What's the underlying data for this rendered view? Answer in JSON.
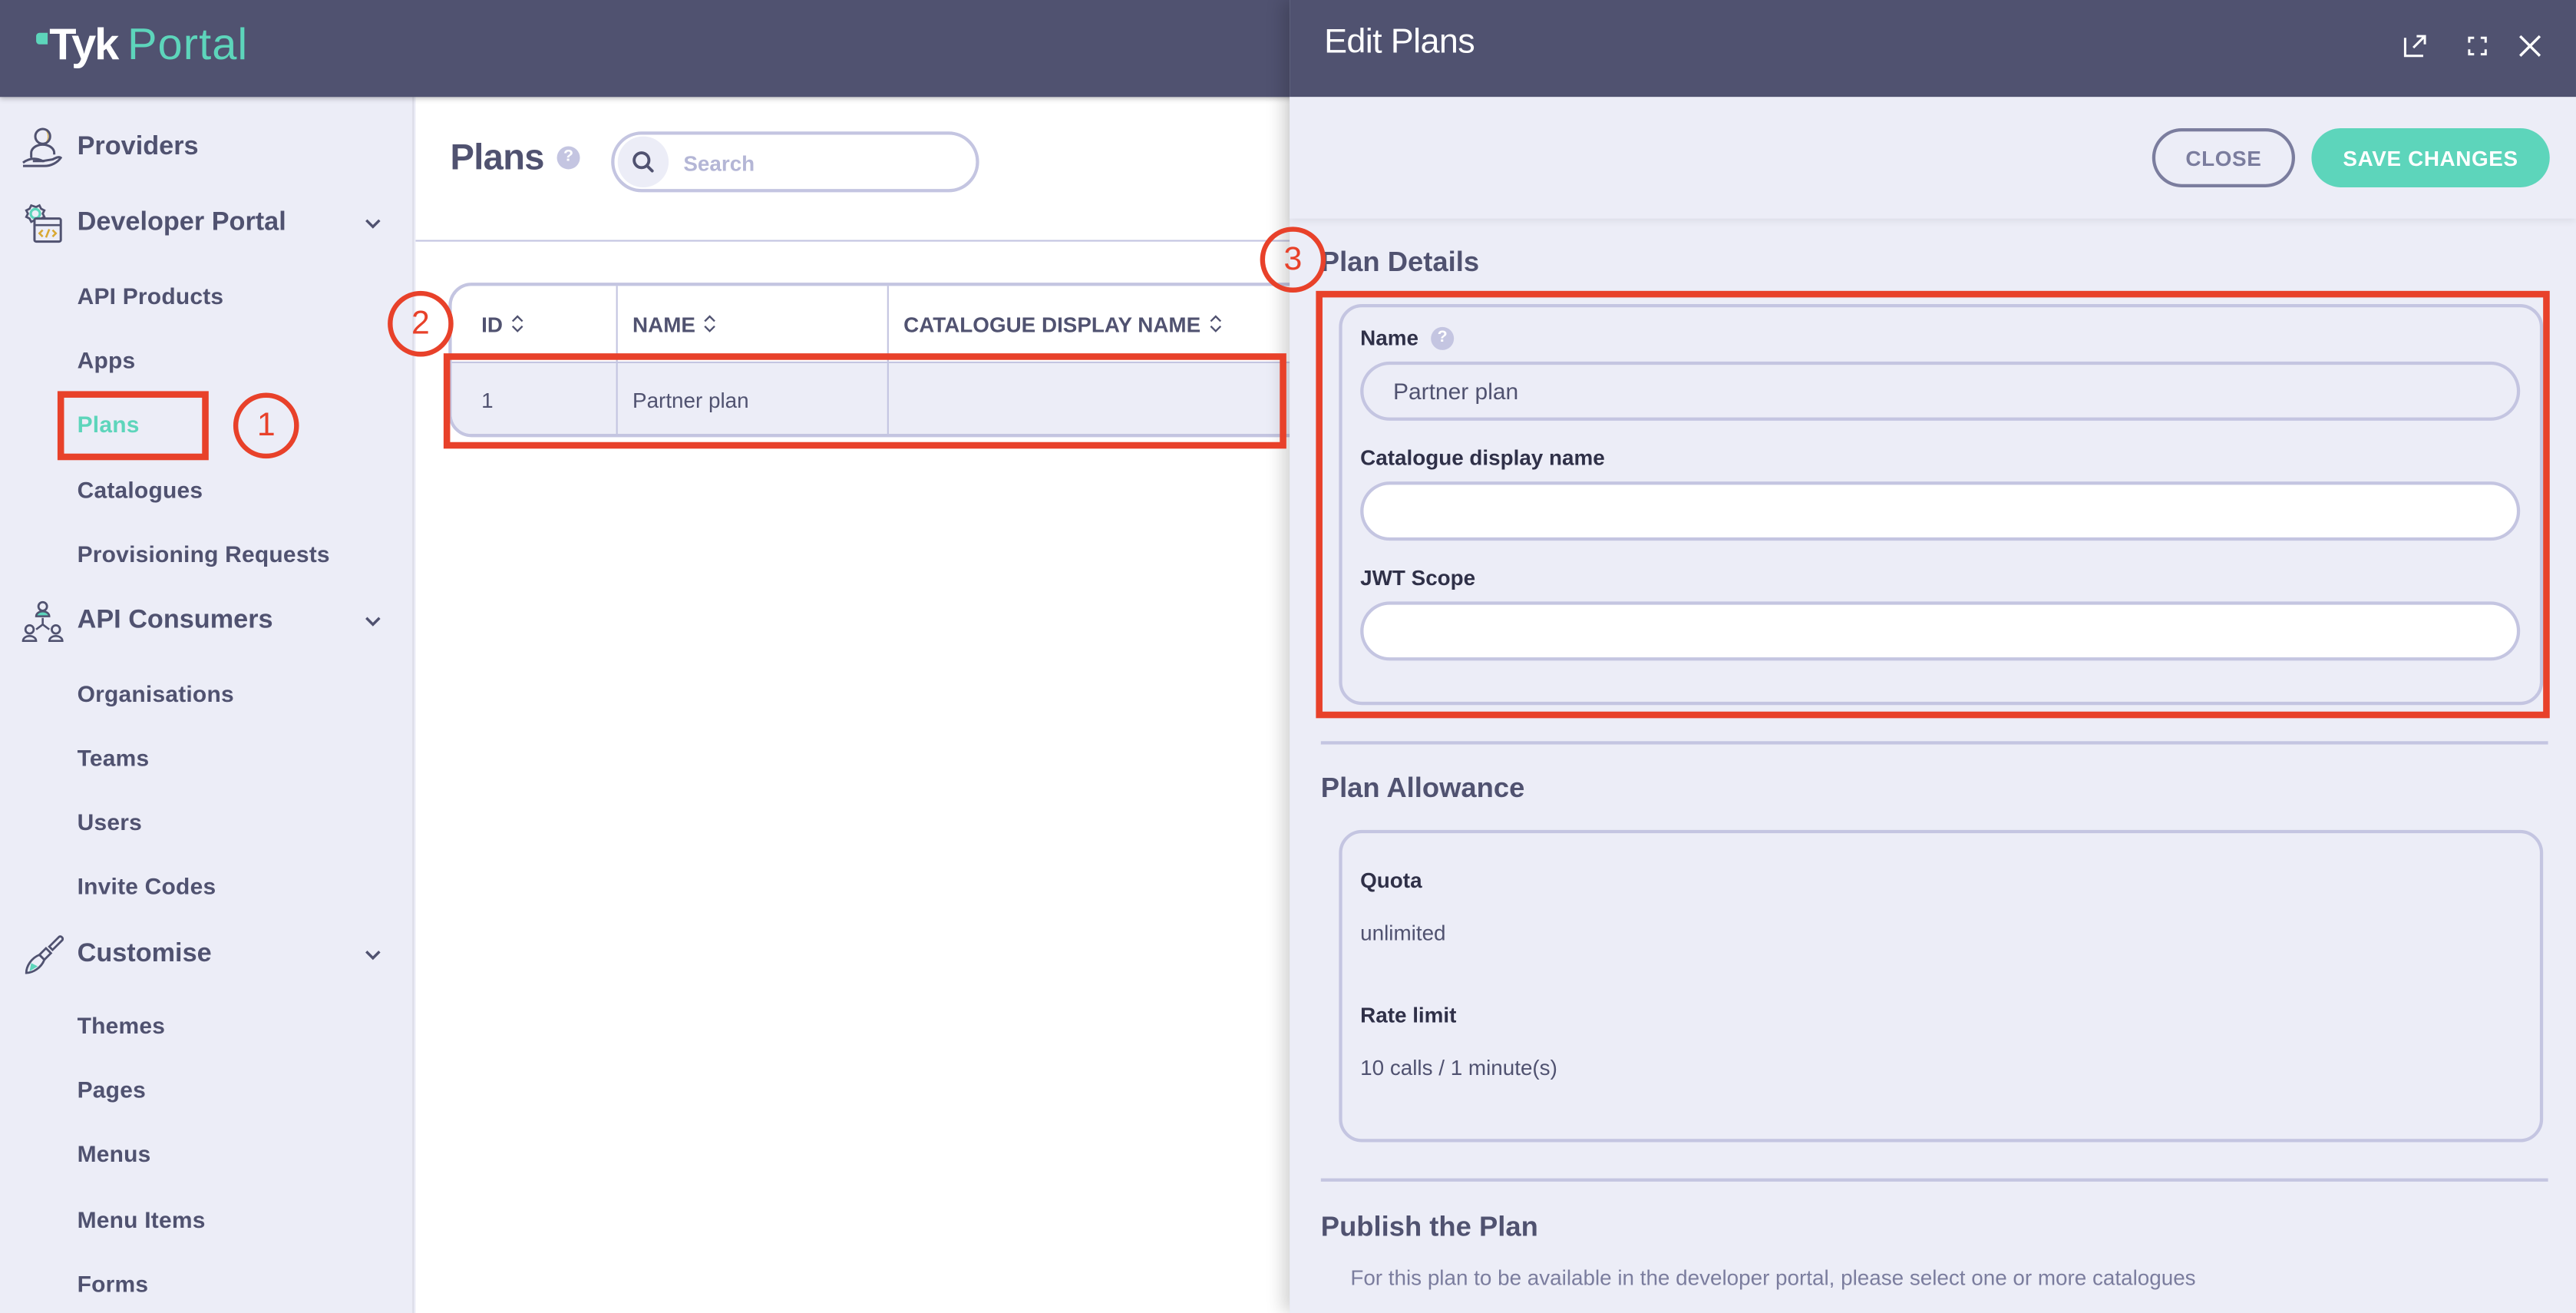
{
  "app": {
    "logo_brand": "Tyk",
    "logo_product": "Portal",
    "accent_color": "#5dd5bb",
    "header_color": "#505270"
  },
  "sidebar": {
    "sections": [
      {
        "label": "Providers",
        "icon": "provider-hand-icon",
        "collapsible": false,
        "items": []
      },
      {
        "label": "Developer Portal",
        "icon": "developer-portal-icon",
        "collapsible": true,
        "expanded": true,
        "items": [
          "API Products",
          "Apps",
          "Plans",
          "Catalogues",
          "Provisioning Requests"
        ]
      },
      {
        "label": "API Consumers",
        "icon": "api-consumers-icon",
        "collapsible": true,
        "expanded": true,
        "items": [
          "Organisations",
          "Teams",
          "Users",
          "Invite Codes"
        ]
      },
      {
        "label": "Customise",
        "icon": "paintbrush-icon",
        "collapsible": true,
        "expanded": true,
        "items": [
          "Themes",
          "Pages",
          "Menus",
          "Menu Items",
          "Forms"
        ]
      }
    ],
    "active_item": "Plans"
  },
  "main": {
    "title": "Plans",
    "help_glyph": "?",
    "search": {
      "placeholder": "Search",
      "value": ""
    },
    "table": {
      "columns": [
        "ID",
        "NAME",
        "CATALOGUE DISPLAY NAME"
      ],
      "rows": [
        {
          "id": "1",
          "name": "Partner plan",
          "catalogue_display_name": ""
        }
      ]
    }
  },
  "drawer": {
    "title": "Edit Plans",
    "header_icons": [
      "open-external-icon",
      "fullscreen-icon",
      "close-icon"
    ],
    "close_label": "CLOSE",
    "save_label": "SAVE CHANGES",
    "plan_details": {
      "title": "Plan Details",
      "fields": [
        {
          "label": "Name",
          "value": "Partner plan",
          "has_help": true
        },
        {
          "label": "Catalogue display name",
          "value": "",
          "has_help": false
        },
        {
          "label": "JWT Scope",
          "value": "",
          "has_help": false
        }
      ]
    },
    "plan_allowance": {
      "title": "Plan Allowance",
      "quota_label": "Quota",
      "quota_value": "unlimited",
      "rate_limit_label": "Rate limit",
      "rate_limit_value": "10 calls / 1 minute(s)"
    },
    "publish": {
      "title": "Publish the Plan",
      "note": "For this plan to be available in the developer portal, please select one or more catalogues"
    }
  },
  "annotations": [
    {
      "number": "1",
      "target": "sidebar Plans item"
    },
    {
      "number": "2",
      "target": "Partner plan table row"
    },
    {
      "number": "3",
      "target": "Plan Details card"
    }
  ],
  "annotation_color": "#e8412a"
}
